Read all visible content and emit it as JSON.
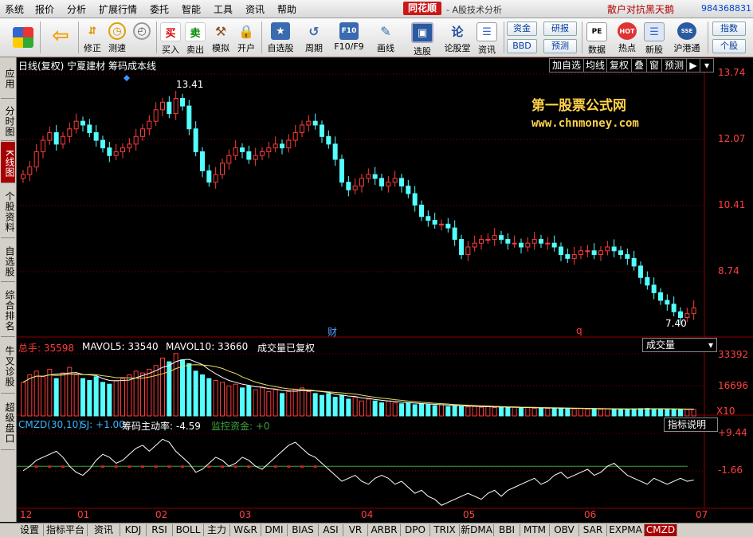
{
  "menu": [
    "系统",
    "报价",
    "分析",
    "扩展行情",
    "委托",
    "智能",
    "工具",
    "资讯",
    "帮助"
  ],
  "brand": "同花顺",
  "subtitle": "- A股技术分析",
  "promo": "散户对抗黑天鹅",
  "account": "984368831",
  "toolbar": {
    "items": [
      {
        "label": "修正",
        "icon": "up-down-arrow-icon"
      },
      {
        "label": "测速",
        "icon": "clock-icon"
      },
      {
        "label": "买入",
        "icon": "buy-icon",
        "glyph": "买"
      },
      {
        "label": "卖出",
        "icon": "sell-icon",
        "glyph": "卖"
      },
      {
        "label": "模拟",
        "icon": "gavel-icon"
      },
      {
        "label": "开户",
        "icon": "lock-icon"
      },
      {
        "label": "自选股",
        "icon": "star-folder-icon"
      },
      {
        "label": "周期",
        "icon": "period-icon"
      },
      {
        "label": "F10/F9",
        "icon": "f10-icon"
      },
      {
        "label": "画线",
        "icon": "pencil-icon"
      },
      {
        "label": "选股",
        "icon": "monitor-icon"
      },
      {
        "label": "论股堂",
        "icon": "forum-icon"
      },
      {
        "label": "资讯",
        "icon": "document-icon"
      },
      {
        "label": "数据",
        "icon": "pe-data-icon"
      },
      {
        "label": "热点",
        "icon": "hot-icon"
      },
      {
        "label": "新股",
        "icon": "new-stock-icon"
      },
      {
        "label": "沪港通",
        "icon": "hk-connect-icon"
      }
    ],
    "mini": {
      "fund": "资金",
      "research": "研报",
      "bbd": "BBD",
      "forecast": "预测",
      "index": "指数",
      "stock": "个股"
    }
  },
  "sidebar": [
    "应用",
    "分时图",
    "K线图",
    "个股资料",
    "自选股",
    "综合排名",
    "牛叉诊股",
    "超级盘口"
  ],
  "chart": {
    "header": "日线(复权) 宁夏建材 筹码成本线",
    "buttons": [
      "加自选",
      "均线",
      "复权",
      "叠",
      "窗",
      "预测"
    ],
    "watermark1": "第一股票公式网",
    "watermark2": "www.chnmoney.com",
    "high_label": "13.41",
    "low_label": "7.40",
    "marker_cai": "财",
    "marker_q": "q",
    "price_axis": [
      "13.74",
      "12.07",
      "10.41",
      "8.74"
    ],
    "vol_header": {
      "total": "总手: 35598",
      "mavol5": "MAVOL5: 33540",
      "mavol10": "MAVOL10: 33660",
      "note": "成交量已复权"
    },
    "vol_dropdown": "成交量",
    "vol_axis": [
      "33392",
      "16696",
      "X10"
    ],
    "ind_header": {
      "name": "CMZD(30,10)",
      "sj": "SJ: +1.00",
      "rate": "筹码主动率: -4.59",
      "monitor": "监控资金: +0"
    },
    "ind_button": "指标说明",
    "ind_axis": [
      "+9.44",
      "-1.66"
    ],
    "months": [
      "12",
      "01",
      "02",
      "03",
      "04",
      "05",
      "06",
      "07"
    ]
  },
  "chart_data": {
    "type": "candlestick",
    "title": "日线(复权) 宁夏建材 筹码成本线",
    "price_range": [
      7.0,
      13.9
    ],
    "high": 13.41,
    "low": 7.4,
    "months": [
      "12",
      "01",
      "02",
      "03",
      "04",
      "05",
      "06",
      "07"
    ],
    "closes": [
      11.2,
      11.4,
      11.8,
      12.1,
      12.3,
      12.0,
      12.2,
      12.4,
      12.6,
      12.5,
      12.3,
      12.1,
      11.9,
      11.7,
      11.8,
      11.9,
      12.0,
      12.2,
      12.4,
      12.6,
      12.9,
      13.1,
      12.8,
      13.2,
      13.0,
      12.4,
      11.8,
      11.3,
      11.0,
      11.2,
      11.5,
      11.7,
      11.9,
      11.8,
      11.6,
      11.7,
      11.8,
      11.9,
      12.0,
      11.9,
      12.1,
      12.3,
      12.5,
      12.6,
      12.5,
      12.2,
      12.0,
      11.6,
      11.0,
      10.8,
      10.9,
      11.1,
      11.2,
      11.1,
      10.9,
      11.0,
      11.1,
      10.9,
      10.7,
      10.4,
      10.1,
      10.0,
      9.9,
      9.9,
      9.8,
      9.5,
      9.1,
      9.3,
      9.4,
      9.5,
      9.5,
      9.6,
      9.5,
      9.4,
      9.4,
      9.3,
      9.4,
      9.5,
      9.4,
      9.4,
      9.3,
      9.1,
      9.0,
      9.1,
      9.2,
      9.2,
      9.1,
      9.2,
      9.3,
      9.2,
      9.1,
      9.0,
      8.8,
      8.5,
      8.3,
      8.1,
      7.9,
      7.8,
      7.6,
      7.45,
      7.55,
      7.7
    ],
    "volume_range": [
      0,
      35000
    ],
    "volumes": [
      18000,
      22000,
      24000,
      21000,
      25000,
      20000,
      23000,
      26000,
      22000,
      20000,
      19000,
      21000,
      18000,
      17000,
      19000,
      20000,
      22000,
      24000,
      23000,
      25000,
      27000,
      31000,
      29000,
      33392,
      30000,
      28000,
      24000,
      22000,
      20000,
      19000,
      18000,
      16000,
      17000,
      15000,
      16000,
      14000,
      15000,
      13000,
      14000,
      12000,
      13000,
      14000,
      15000,
      13000,
      12000,
      11000,
      12000,
      10000,
      11000,
      9000,
      10000,
      8000,
      9000,
      8000,
      7000,
      8000,
      7000,
      6500,
      7000,
      6000,
      6500,
      6000,
      5500,
      6000,
      5000,
      5500,
      5000,
      4800,
      5200,
      4600,
      5000,
      4500,
      4800,
      4400,
      4600,
      4200,
      4500,
      4100,
      4300,
      4000,
      4200,
      3900,
      4100,
      3800,
      4000,
      3700,
      3900,
      3600,
      3800,
      3500,
      3700,
      3600,
      3800,
      3900,
      4000,
      3800,
      3600,
      3700,
      3500,
      3600,
      3400,
      3500
    ],
    "indicator_range": [
      -14,
      12
    ],
    "indicator": [
      -1.5,
      0,
      2,
      3,
      4,
      5,
      3,
      0,
      -2,
      -3,
      -1,
      2,
      4,
      3,
      1,
      2,
      4,
      6,
      7,
      5,
      7,
      9,
      8,
      5,
      3,
      1,
      -2,
      -1,
      1,
      3,
      2,
      0,
      1,
      3,
      2,
      0,
      -1,
      1,
      3,
      5,
      7,
      8,
      6,
      4,
      3,
      1,
      -1,
      -3,
      -5,
      -4,
      -3,
      -5,
      -6,
      -4,
      -3,
      -4,
      -6,
      -5,
      -7,
      -9,
      -8,
      -10,
      -11,
      -13,
      -12,
      -11,
      -10,
      -9,
      -10,
      -11,
      -9,
      -8,
      -10,
      -8,
      -7,
      -6,
      -5,
      -4,
      -6,
      -5,
      -3,
      -2,
      -4,
      -3,
      -2,
      -1,
      -3,
      -2,
      0,
      1,
      -1,
      -3,
      -4,
      -5,
      -6,
      -4,
      -5,
      -6,
      -5,
      -4,
      -5,
      -4.59
    ]
  },
  "bottom_tabs": [
    "设置",
    "指标平台",
    "资讯",
    "KDJ",
    "RSI",
    "BOLL",
    "主力",
    "W&R",
    "DMI",
    "BIAS",
    "ASI",
    "VR",
    "ARBR",
    "DPO",
    "TRIX",
    "新DMA",
    "BBI",
    "MTM",
    "OBV",
    "SAR",
    "EXPMA",
    "CMZD"
  ],
  "colors": {
    "up": "#ff3b3b",
    "down": "#54ffff",
    "grid": "#8a0000",
    "ma_line": "#ffffff",
    "ind_line": "#ffffff",
    "green_line": "#3ca03c"
  }
}
